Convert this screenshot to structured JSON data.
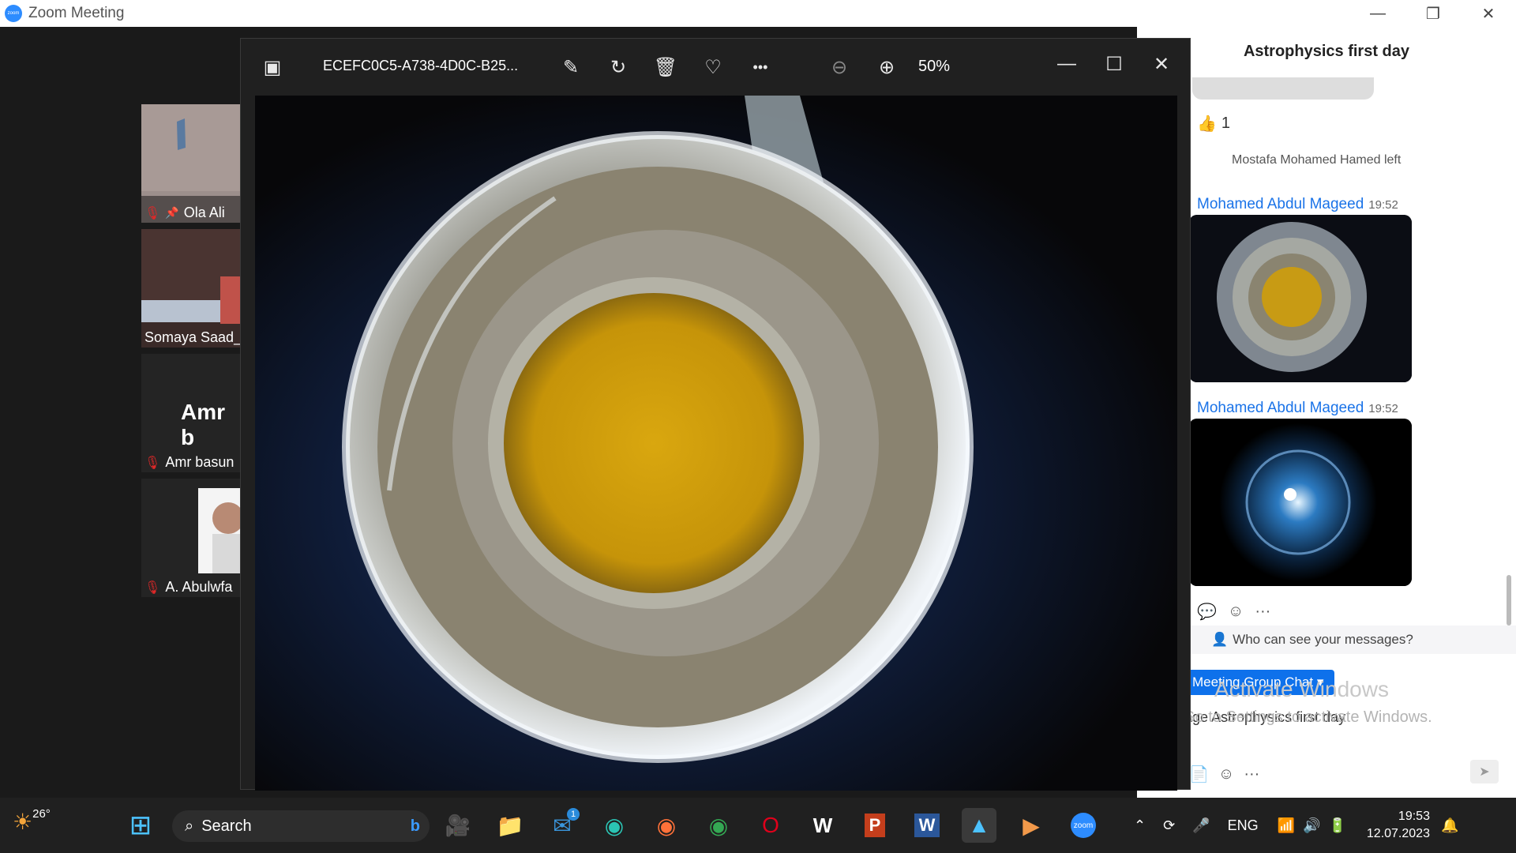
{
  "zoom_window": {
    "title": "Zoom Meeting",
    "logo_text": "zoom",
    "minimize": "—",
    "restore": "❐",
    "close": "✕"
  },
  "participants": [
    {
      "name": "Ola Ali",
      "muted": true,
      "pinned": true
    },
    {
      "name": "Somaya Saad_",
      "muted": false,
      "pinned": false
    },
    {
      "name": "Amr basun",
      "display": "Amr b",
      "muted": true,
      "pinned": false
    },
    {
      "name": "A. Abulwfa",
      "muted": true,
      "pinned": false
    }
  ],
  "photo_viewer": {
    "filename": "ECEFC0C5-A738-4D0C-B25...",
    "zoom_level": "50%",
    "more": "•••",
    "minimize": "—",
    "maximize": "☐",
    "close": "✕"
  },
  "chat": {
    "title": "Astrophysics first day",
    "reaction": {
      "emoji": "👍",
      "count": "1"
    },
    "system_message": "Mostafa Mohamed Hamed left",
    "messages": [
      {
        "sender": "Mohamed Abdul Mageed",
        "time": "19:52"
      },
      {
        "sender": "Mohamed Abdul Mageed",
        "time": "19:52"
      }
    ],
    "actions_more": "···",
    "privacy_text": "Who can see your messages?",
    "group_button": "Meeting Group Chat",
    "to_label": "age Astrophysics first day",
    "composer_more": "···"
  },
  "watermark": {
    "line1": "Activate Windows",
    "line2": "Go to Settings to activate Windows."
  },
  "taskbar": {
    "weather_temp": "26°",
    "search_placeholder": "Search",
    "mail_badge": "1",
    "language": "ENG",
    "time": "19:53",
    "date": "12.07.2023",
    "zoom_logo": "zoom"
  },
  "colors": {
    "accent": "#0e71eb",
    "link": "#1a73e8",
    "zoom_blue": "#2d8cff",
    "muted_red": "#e02828"
  }
}
